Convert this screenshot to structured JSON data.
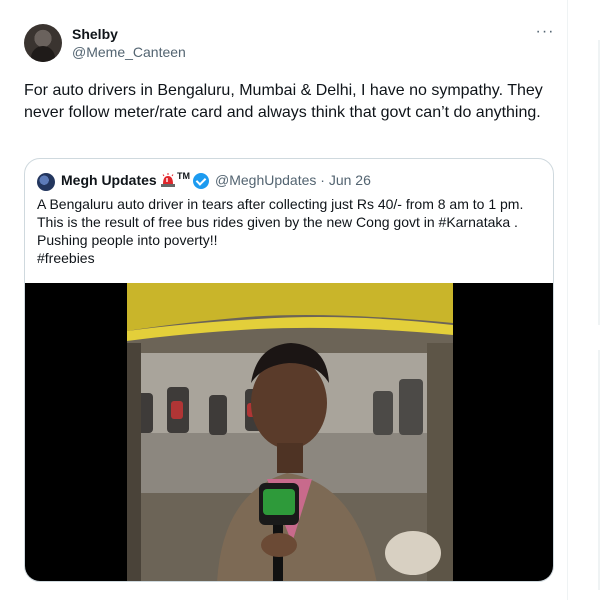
{
  "tweet": {
    "author_name": "Shelby",
    "author_handle": "@Meme_Canteen",
    "more_label": "···",
    "text": "For auto drivers in Bengaluru, Mumbai & Delhi, I have no sympathy. They never follow meter/rate card and always think that govt can’t do anything."
  },
  "quote": {
    "author_name": "Megh Updates",
    "tm": "TM",
    "handle_date": "@MeghUpdates · Jun 26",
    "lines": [
      "A Bengaluru auto driver in tears after collecting just Rs 40/- from 8 am to 1 pm.",
      "This is the result of free bus rides given by the new Cong govt in #Karnataka .",
      "Pushing people into poverty!!",
      "#freebies"
    ],
    "media": {
      "description_icon": "video-thumbnail"
    }
  },
  "colors": {
    "text": "#0f1419",
    "secondary": "#536471",
    "border": "#cfd9de",
    "verified": "#1d9bf0"
  }
}
